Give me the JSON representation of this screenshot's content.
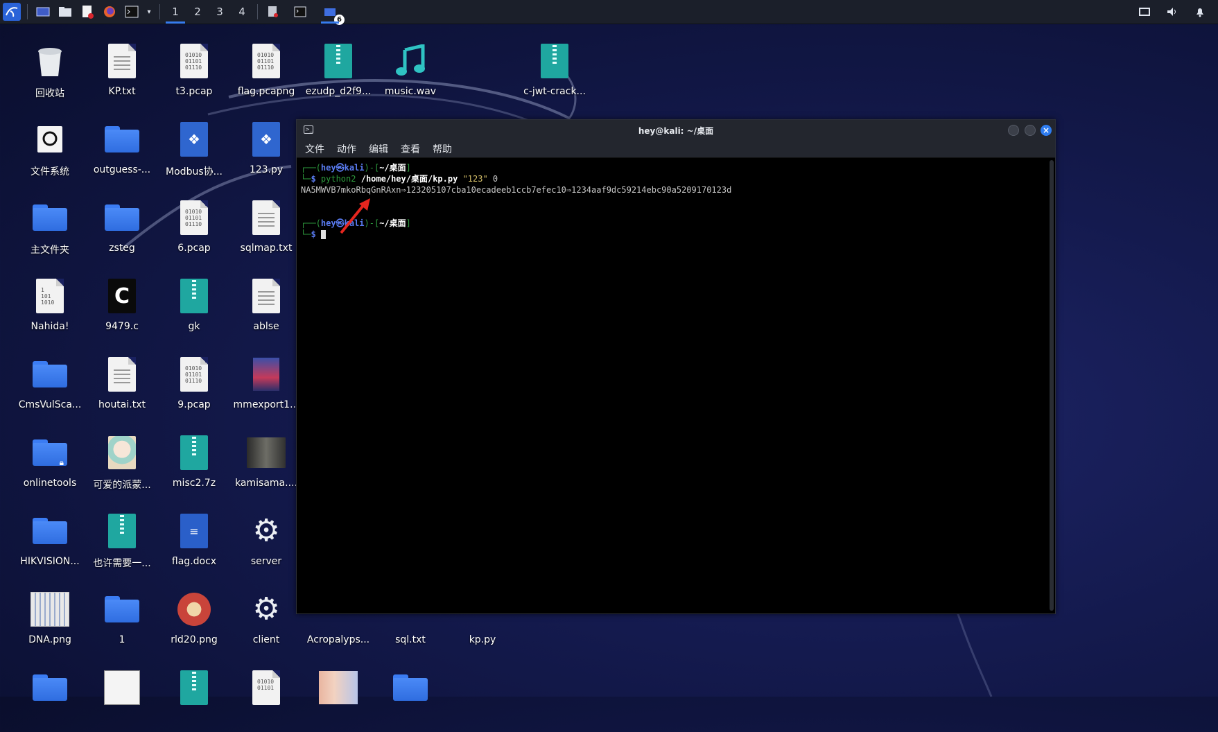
{
  "taskbar": {
    "workspaces": [
      "1",
      "2",
      "3",
      "4"
    ],
    "badge_count": "6"
  },
  "desktop": {
    "icons": [
      {
        "label": "回收站",
        "kind": "trash"
      },
      {
        "label": "KP.txt",
        "kind": "text"
      },
      {
        "label": "t3.pcap",
        "kind": "binary"
      },
      {
        "label": "flag.pcapng",
        "kind": "binary"
      },
      {
        "label": "ezudp_d2f9...",
        "kind": "zip"
      },
      {
        "label": "music.wav",
        "kind": "audio"
      },
      {
        "label": "c-jwt-crack...",
        "kind": "zip"
      },
      {
        "label": "文件系统",
        "kind": "drive"
      },
      {
        "label": "outguess-...",
        "kind": "folder"
      },
      {
        "label": "Modbus协...",
        "kind": "python"
      },
      {
        "label": "123.py",
        "kind": "python"
      },
      {
        "label": "主文件夹",
        "kind": "home"
      },
      {
        "label": "zsteg",
        "kind": "folder"
      },
      {
        "label": "6.pcap",
        "kind": "binary"
      },
      {
        "label": "sqlmap.txt",
        "kind": "text"
      },
      {
        "label": "Nahida!",
        "kind": "binary"
      },
      {
        "label": "9479.c",
        "kind": "c-source"
      },
      {
        "label": "gk",
        "kind": "zip"
      },
      {
        "label": "ablse",
        "kind": "text"
      },
      {
        "label": "CmsVulSca...",
        "kind": "folder"
      },
      {
        "label": "houtai.txt",
        "kind": "text"
      },
      {
        "label": "9.pcap",
        "kind": "binary"
      },
      {
        "label": "mmexport1...",
        "kind": "image"
      },
      {
        "label": "onlinetools",
        "kind": "folder-locked"
      },
      {
        "label": "可爱的派蒙...",
        "kind": "image"
      },
      {
        "label": "misc2.7z",
        "kind": "zip"
      },
      {
        "label": "kamisama....",
        "kind": "image"
      },
      {
        "label": "HIKVISION...",
        "kind": "folder"
      },
      {
        "label": "也许需要一...",
        "kind": "zip"
      },
      {
        "label": "flag.docx",
        "kind": "document"
      },
      {
        "label": "server",
        "kind": "gear"
      },
      {
        "label": "DNA.png",
        "kind": "image"
      },
      {
        "label": "1",
        "kind": "folder"
      },
      {
        "label": "rld20.png",
        "kind": "image"
      },
      {
        "label": "client",
        "kind": "gear"
      },
      {
        "label": "Acropalyps...",
        "kind": "folder"
      },
      {
        "label": "sql.txt",
        "kind": "text"
      },
      {
        "label": "kp.py",
        "kind": "python"
      }
    ]
  },
  "terminal": {
    "title": "hey@kali: ~/桌面",
    "menu": [
      "文件",
      "动作",
      "编辑",
      "查看",
      "帮助"
    ],
    "user": "hey",
    "host": "kali",
    "cwd": "~/桌面",
    "command_bin": "python2",
    "command_path": "/home/hey/桌面/kp.py",
    "command_arg_str": "\"123\"",
    "command_arg_num": "0",
    "output": "NA5MWVB7mkoRbqGnRAxn⇒123205107cba10ecadeeb1ccb7efec10⇒1234aaf9dc59214ebc90a5209170123d"
  }
}
